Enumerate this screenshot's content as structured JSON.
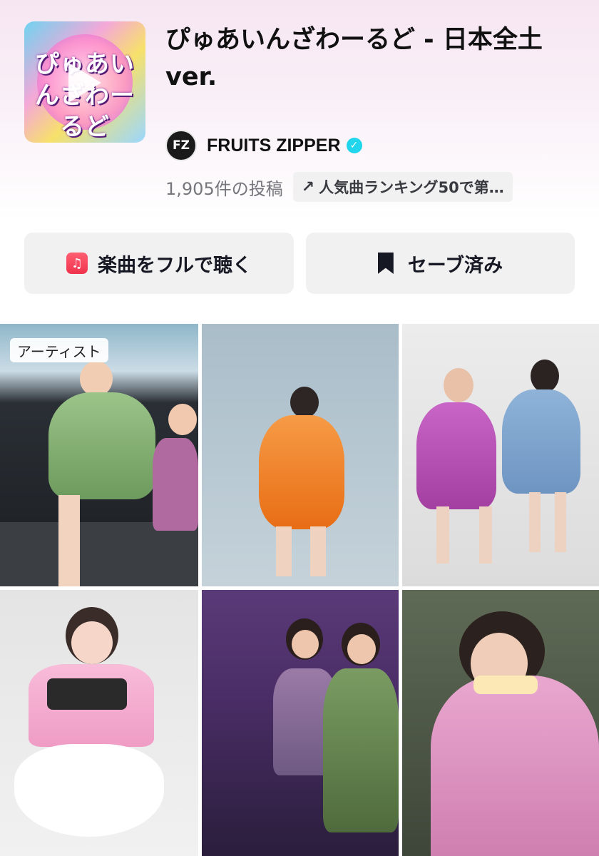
{
  "sound": {
    "title": "ぴゅあいんざわーるど - 日本全土 ver.",
    "cover_text": "ぴゅあいんざわーるど",
    "artist": {
      "avatar_text": "FZ",
      "name": "FRUITS ZIPPER",
      "verified": true
    },
    "post_count": "1,905件の投稿",
    "ranking_chip": "人気曲ランキング50で第…",
    "ranking_icon": "trending-up-icon"
  },
  "actions": {
    "listen_label": "楽曲をフルで聴く",
    "listen_icon": "apple-music-icon",
    "save_label": "セーブ済み",
    "save_icon": "bookmark-icon"
  },
  "videos": [
    {
      "badge": "アーティスト",
      "scene": "live-stage",
      "outfit_color": "#7fb06a"
    },
    {
      "badge": "",
      "scene": "studio",
      "outfit_color": "#f47a1f"
    },
    {
      "badge": "",
      "scene": "studio-duo",
      "outfit_color": "#b94bb8"
    },
    {
      "badge": "",
      "scene": "studio",
      "outfit_color": "#f3a7cf"
    },
    {
      "badge": "",
      "scene": "live-stage-duo",
      "outfit_color": "#6b8a4e"
    },
    {
      "badge": "",
      "scene": "live-stage",
      "outfit_color": "#d97fb4"
    }
  ],
  "colors": {
    "accent_verified": "#20d5ec",
    "button_bg": "#f1f1f2",
    "text_secondary": "#76777c"
  }
}
